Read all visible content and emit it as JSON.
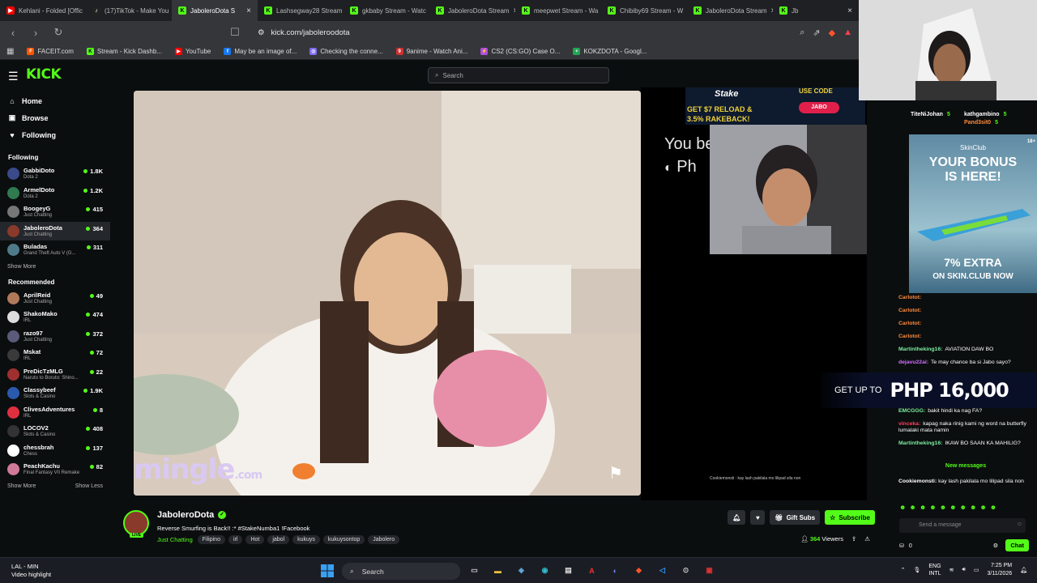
{
  "tabs": [
    {
      "label": "Kehlani - Folded [Offic",
      "color": "#ff0000",
      "glyph": "▶"
    },
    {
      "label": "(17)TikTok - Make You",
      "color": "#222",
      "glyph": "♪"
    },
    {
      "label": "JaboleroDota S",
      "color": "#53fc18",
      "glyph": "K",
      "active": true
    },
    {
      "label": "Lashsegway28 Stream",
      "color": "#53fc18",
      "glyph": "K"
    },
    {
      "label": "gkbaby Stream - Watc",
      "color": "#53fc18",
      "glyph": "K"
    },
    {
      "label": "JaboleroDota Stream",
      "color": "#53fc18",
      "glyph": "K"
    },
    {
      "label": "meepwet Stream - Wa",
      "color": "#53fc18",
      "glyph": "K"
    },
    {
      "label": "Chibiby69 Stream - W",
      "color": "#53fc18",
      "glyph": "K"
    },
    {
      "label": "JaboleroDota Stream",
      "color": "#53fc18",
      "glyph": "K"
    },
    {
      "label": "Jb",
      "color": "#53fc18",
      "glyph": "K"
    }
  ],
  "address": {
    "url": "kick.com/jaboleroodota"
  },
  "bookmarks": [
    {
      "label": "FACEIT.com",
      "color": "#ff5500",
      "glyph": "F"
    },
    {
      "label": "Stream - Kick Dashb...",
      "color": "#53fc18",
      "glyph": "K"
    },
    {
      "label": "YouTube",
      "color": "#ff0000",
      "glyph": "▶"
    },
    {
      "label": "May be an image of...",
      "color": "#1877f2",
      "glyph": "f"
    },
    {
      "label": "Checking the conne...",
      "color": "#7c6cf0",
      "glyph": "◎"
    },
    {
      "label": "9anime - Watch Ani...",
      "color": "#d03030",
      "glyph": "9"
    },
    {
      "label": "CS2 (CS:GO) Case O...",
      "color": "#b04de0",
      "glyph": "⚡"
    },
    {
      "label": "KOKZDOTA - Googl...",
      "color": "#23a455",
      "glyph": "+"
    }
  ],
  "header": {
    "logo": "KICK",
    "search_placeholder": "Search"
  },
  "nav": [
    {
      "label": "Home",
      "icon": "⌂"
    },
    {
      "label": "Browse",
      "icon": "▣"
    },
    {
      "label": "Following",
      "icon": "♥"
    }
  ],
  "following_title": "Following",
  "following": [
    {
      "name": "GabbiDoto",
      "cat": "Dota 2",
      "viewers": "1.8K",
      "color": "#3a4a8a"
    },
    {
      "name": "ArmelDoto",
      "cat": "Dota 2",
      "viewers": "1.2K",
      "color": "#2f7a4f"
    },
    {
      "name": "BoogeyG",
      "cat": "Just Chatting",
      "viewers": "415",
      "color": "#777"
    },
    {
      "name": "JaboleroDota",
      "cat": "Just Chatting",
      "viewers": "364",
      "color": "#8a3a2a",
      "selected": true
    },
    {
      "name": "Buladas",
      "cat": "Grand Theft Auto V (G...",
      "viewers": "311",
      "color": "#4f7a8a"
    }
  ],
  "following_more": "Show More",
  "recommended_title": "Recommended",
  "recommended": [
    {
      "name": "AprilReid",
      "cat": "Just Chatting",
      "viewers": "49",
      "color": "#b07a5a"
    },
    {
      "name": "ShakoMako",
      "cat": "IRL",
      "viewers": "474",
      "color": "#ddd"
    },
    {
      "name": "razo97",
      "cat": "Just Chatting",
      "viewers": "372",
      "color": "#5a5a7a"
    },
    {
      "name": "Mskat",
      "cat": "IRL",
      "viewers": "72",
      "color": "#3a3a3a"
    },
    {
      "name": "PreDicTzMLG",
      "cat": "Naruto to Boruto: Shino...",
      "viewers": "22",
      "color": "#a03030"
    },
    {
      "name": "Classybeef",
      "cat": "Slots & Casino",
      "viewers": "1.9K",
      "color": "#2a5ab0"
    },
    {
      "name": "ClivesAdventures",
      "cat": "IRL",
      "viewers": "8",
      "color": "#e03040"
    },
    {
      "name": "LOCOV2",
      "cat": "Slots & Casino",
      "viewers": "408",
      "color": "#333"
    },
    {
      "name": "chessbrah",
      "cat": "Chess",
      "viewers": "137",
      "color": "#fff"
    },
    {
      "name": "PeachKachu",
      "cat": "Final Fantasy VII Remake",
      "viewers": "82",
      "color": "#d07a9a"
    }
  ],
  "recommended_more": "Show More",
  "recommended_less": "Show Less",
  "player": {
    "watermark": "mingle",
    "watermark_suffix": ".com",
    "overlay_text_1": "You be",
    "overlay_text_2": "Ph",
    "overlay_chat": "Cookiemonsti : kay lash pakilala mo lilipad sila non"
  },
  "stake": {
    "brand": "Stake",
    "line1": "GET $7 RELOAD &",
    "line2": "3.5% RAKEBACK!",
    "code_label": "USE CODE",
    "code": "JABO"
  },
  "stream": {
    "name": "JaboleroDota",
    "title": "Reverse Smurfing is Back!! :* #StakeNumba1 !Facebook",
    "live": "LIVE",
    "category": "Just Chatting",
    "tags": [
      "Filipino",
      "irl",
      "Hot",
      "jabol",
      "kukuys",
      "kukuysontop",
      "Jabolero"
    ],
    "gift": "Gift Subs",
    "subscribe": "Subscribe",
    "viewers": "364",
    "viewers_label": "Viewers"
  },
  "chat": {
    "top": [
      {
        "name": "TiteNiJohan",
        "count": "5"
      },
      {
        "name": "kathgambino",
        "count": "5"
      },
      {
        "name": "Pand3sit0",
        "count": "5"
      }
    ],
    "ad": {
      "brand": "SkinClub",
      "line1": "YOUR BONUS",
      "line2": "IS HERE!",
      "line3": "7% EXTRA",
      "line4": "ON SKIN.CLUB NOW",
      "age": "18+"
    },
    "lines": [
      {
        "user": "Carlotot:",
        "text": "",
        "color": "#ff8a3d"
      },
      {
        "user": "Carlotot:",
        "text": "",
        "color": "#ff8a3d"
      },
      {
        "user": "Carlotot:",
        "text": "",
        "color": "#ff8a3d"
      },
      {
        "user": "Carlotot:",
        "text": "",
        "color": "#ff8a3d"
      },
      {
        "user": "Martintheking16:",
        "text": "AVIATION DAW BO",
        "color": "#7cf0a0"
      },
      {
        "user": "dejavu22ai:",
        "text": "Te may chance ba si Jabo sayo?",
        "color": "#d070ff"
      },
      {
        "user": "EMCGGG:",
        "text": "bakit hindi ka nag FA?",
        "color": "#7cf0a0"
      },
      {
        "user": "vinceka:",
        "text": "kapag naka rinig kami ng word na butterfly lumalaki mata namin",
        "color": "#ff4060"
      },
      {
        "user": "Martintheking16:",
        "text": "IKAW BO SAAN KA MAHILIG?",
        "color": "#7cf0a0"
      }
    ],
    "promo_a": "GET UP TO",
    "promo_b": "PHP 16,000",
    "new_messages": "New messages",
    "last": {
      "user": "Cookiemonsti:",
      "text": "kay lash pakilala mo lilipad sila non"
    },
    "input_placeholder": "Send a message",
    "points": "0",
    "chat_button": "Chat"
  },
  "taskbar": {
    "weather_1": "LAL - MIN",
    "weather_2": "Video highlight",
    "search": "Search",
    "lang_1": "ENG",
    "lang_2": "INTL",
    "time": "7:25 PM",
    "date": "3/11/2026"
  }
}
